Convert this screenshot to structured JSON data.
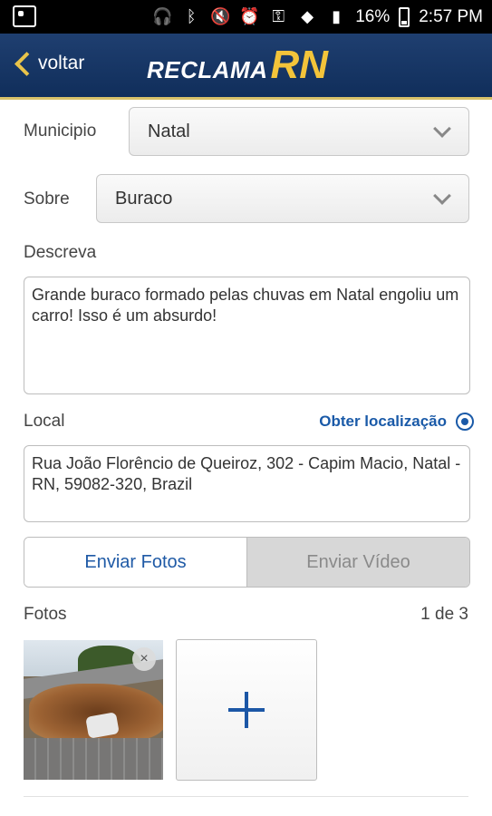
{
  "status_bar": {
    "battery_percent": "16%",
    "time": "2:57 PM",
    "icons": [
      "headphones-icon",
      "bluetooth-icon",
      "mute-icon",
      "alarm-icon",
      "key-icon",
      "wifi-icon",
      "signal-icon",
      "battery-icon"
    ]
  },
  "header": {
    "back_label": "voltar",
    "logo_text_1": "RECLAMA",
    "logo_text_2": "RN",
    "accent_color": "#f3c43a",
    "bg_color": "#16386a"
  },
  "form": {
    "municipio_label": "Municipio",
    "municipio_value": "Natal",
    "sobre_label": "Sobre",
    "sobre_value": "Buraco",
    "descreva_label": "Descreva",
    "descreva_value": "Grande buraco formado pelas chuvas em Natal engoliu um carro! Isso é um absurdo!",
    "local_label": "Local",
    "geolocate_label": "Obter localização",
    "local_value": "Rua João Florêncio de Queiroz, 302 - Capim Macio, Natal - RN, 59082-320, Brazil"
  },
  "media_tabs": {
    "photos_tab": "Enviar Fotos",
    "video_tab": "Enviar Vídeo",
    "active": "photos_tab"
  },
  "photos": {
    "label": "Fotos",
    "counter": "1 de 3",
    "remove_symbol": "×",
    "add_icon": "plus-icon"
  }
}
